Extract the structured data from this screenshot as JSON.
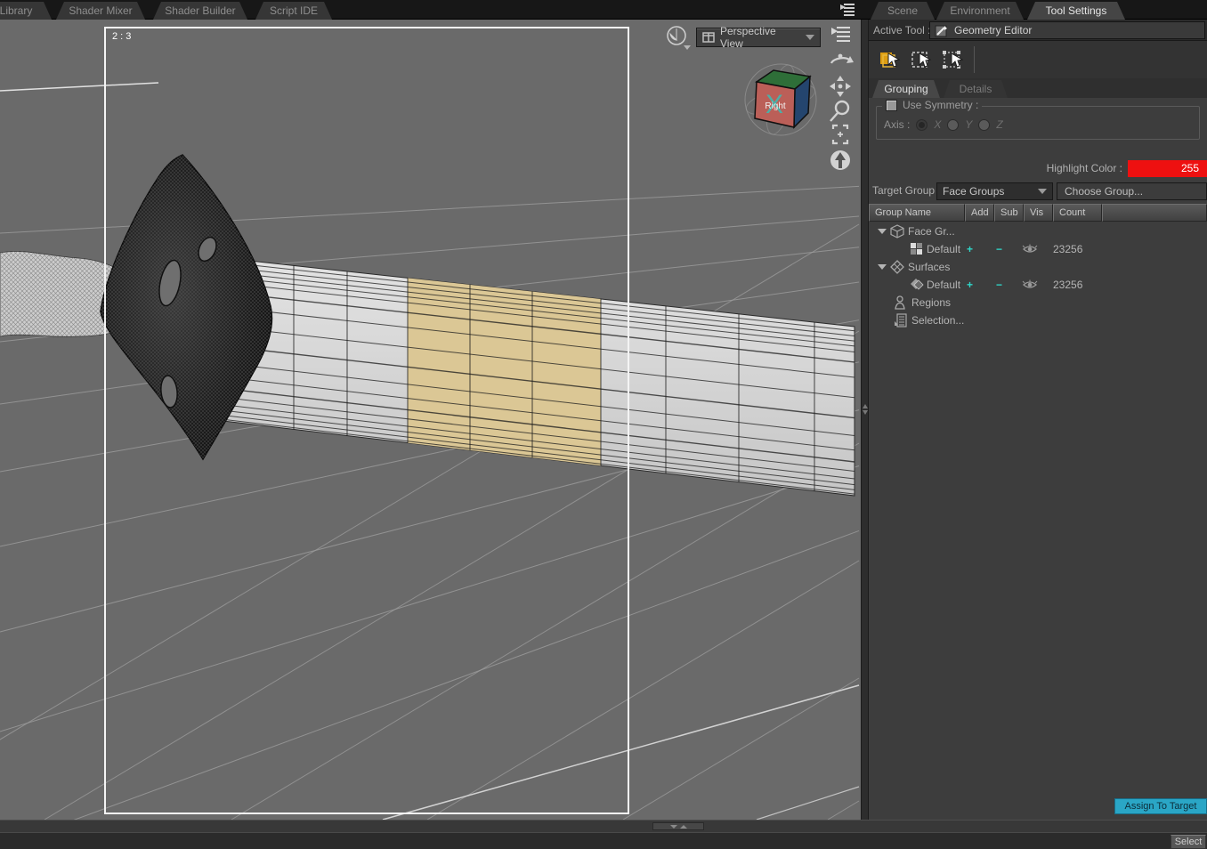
{
  "tabs": {
    "left": [
      {
        "label": "Library"
      },
      {
        "label": "Shader Mixer"
      },
      {
        "label": "Shader Builder"
      },
      {
        "label": "Script IDE"
      }
    ],
    "right": [
      {
        "label": "Scene"
      },
      {
        "label": "Environment"
      },
      {
        "label": "Tool Settings",
        "active": true
      }
    ]
  },
  "viewport": {
    "aspect_label": "2 : 3",
    "view_selector": "Perspective View",
    "cube_gizmo": {
      "face_label": "Right",
      "axis_letter": "X"
    },
    "nav_icons": [
      "orbit-icon",
      "pan-icon",
      "zoom-icon",
      "frame-icon",
      "aim-icon"
    ]
  },
  "tool_settings": {
    "active_tool_label": "Active Tool :",
    "active_tool_value": "Geometry Editor",
    "tabs": [
      {
        "label": "Grouping",
        "active": true
      },
      {
        "label": "Details",
        "active": false
      }
    ],
    "symmetry": {
      "label": "Use Symmetry :",
      "checked": false,
      "axis_label": "Axis :",
      "axes": [
        {
          "letter": "X",
          "selected": true
        },
        {
          "letter": "Y",
          "selected": false
        },
        {
          "letter": "Z",
          "selected": false
        }
      ]
    },
    "highlight_color": {
      "label": "Highlight Color :",
      "value": "255",
      "color": "#ee1010"
    },
    "target_group": {
      "label": "Target Group :",
      "value": "Face Groups",
      "choose_button": "Choose Group..."
    },
    "table": {
      "headers": [
        "Group Name",
        "Add",
        "Sub",
        "Vis",
        "Count"
      ],
      "rows": [
        {
          "label": "Face Gr...",
          "kind": "group",
          "icon": "cube-icon"
        },
        {
          "label": "Default",
          "kind": "item",
          "icon": "facegroup-icon",
          "add": "+",
          "sub": "−",
          "count": "23256"
        },
        {
          "label": "Surfaces",
          "kind": "group",
          "icon": "surfaces-icon"
        },
        {
          "label": "Default",
          "kind": "item",
          "icon": "surface-icon",
          "add": "+",
          "sub": "−",
          "count": "23256"
        },
        {
          "label": "Regions",
          "kind": "leaf",
          "icon": "person-icon"
        },
        {
          "label": "Selection...",
          "kind": "leaf",
          "icon": "selection-icon"
        }
      ]
    },
    "assign_button": "Assign To Target",
    "accent_color": "#2aa6c6"
  },
  "status_bar": {
    "select_label": "Select"
  }
}
